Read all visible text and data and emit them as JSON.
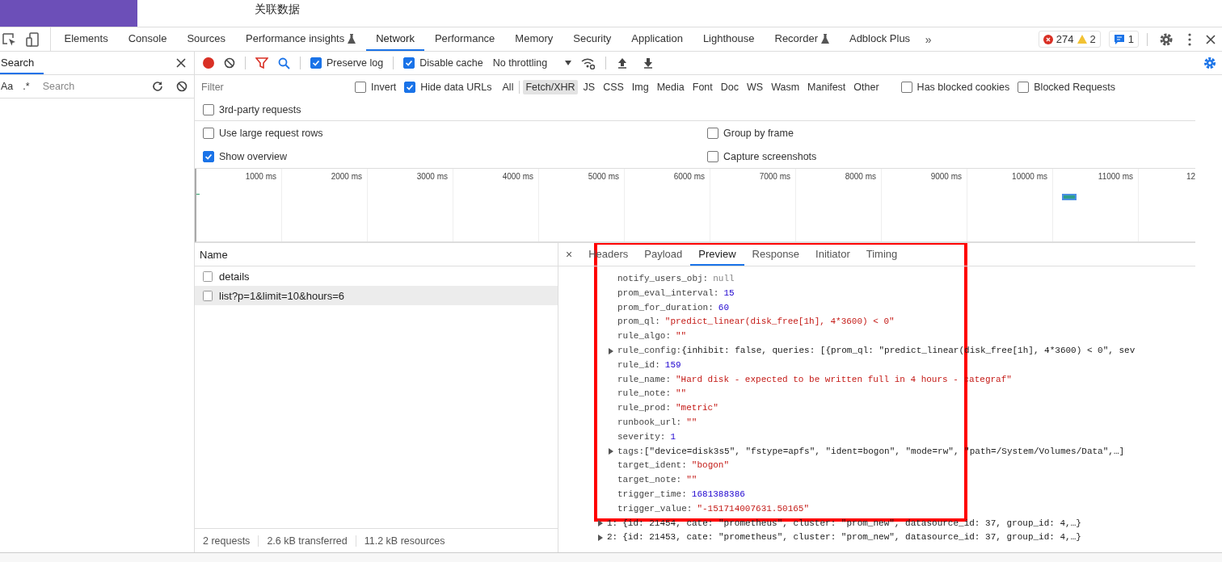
{
  "page_strip": {
    "tab_label": "关联数据"
  },
  "devtools": {
    "tabs": [
      {
        "label": "Elements",
        "selected": false,
        "experimental": false
      },
      {
        "label": "Console",
        "selected": false,
        "experimental": false
      },
      {
        "label": "Sources",
        "selected": false,
        "experimental": false
      },
      {
        "label": "Performance insights",
        "selected": false,
        "experimental": true
      },
      {
        "label": "Network",
        "selected": true,
        "experimental": false
      },
      {
        "label": "Performance",
        "selected": false,
        "experimental": false
      },
      {
        "label": "Memory",
        "selected": false,
        "experimental": false
      },
      {
        "label": "Security",
        "selected": false,
        "experimental": false
      },
      {
        "label": "Application",
        "selected": false,
        "experimental": false
      },
      {
        "label": "Lighthouse",
        "selected": false,
        "experimental": false
      },
      {
        "label": "Recorder",
        "selected": false,
        "experimental": true
      },
      {
        "label": "Adblock Plus",
        "selected": false,
        "experimental": false
      }
    ],
    "more_tabs": "»",
    "errors": "274",
    "warnings": "2",
    "messages": "1"
  },
  "search_panel": {
    "title": "Search",
    "match_case": "Aa",
    "regex": ".*",
    "placeholder": "Search"
  },
  "toolbar": {
    "recording": true,
    "preserve_log": {
      "label": "Preserve log",
      "checked": true
    },
    "disable_cache": {
      "label": "Disable cache",
      "checked": true
    },
    "throttling": "No throttling"
  },
  "filter": {
    "placeholder": "Filter",
    "invert": {
      "label": "Invert",
      "checked": false
    },
    "hide_data_urls": {
      "label": "Hide data URLs",
      "checked": true
    },
    "types": [
      {
        "label": "All",
        "selected": false
      },
      {
        "label": "Fetch/XHR",
        "selected": true
      },
      {
        "label": "JS",
        "selected": false
      },
      {
        "label": "CSS",
        "selected": false
      },
      {
        "label": "Img",
        "selected": false
      },
      {
        "label": "Media",
        "selected": false
      },
      {
        "label": "Font",
        "selected": false
      },
      {
        "label": "Doc",
        "selected": false
      },
      {
        "label": "WS",
        "selected": false
      },
      {
        "label": "Wasm",
        "selected": false
      },
      {
        "label": "Manifest",
        "selected": false
      },
      {
        "label": "Other",
        "selected": false
      }
    ],
    "has_blocked_cookies": {
      "label": "Has blocked cookies",
      "checked": false
    },
    "blocked_requests": {
      "label": "Blocked Requests",
      "checked": false
    },
    "third_party": {
      "label": "3rd-party requests",
      "checked": false
    }
  },
  "settings": [
    {
      "label": "Use large request rows",
      "checked": false
    },
    {
      "label": "Group by frame",
      "checked": false
    },
    {
      "label": "Show overview",
      "checked": true
    },
    {
      "label": "Capture screenshots",
      "checked": false
    }
  ],
  "overview": {
    "ticks": [
      "1000 ms",
      "2000 ms",
      "3000 ms",
      "4000 ms",
      "5000 ms",
      "6000 ms",
      "7000 ms",
      "8000 ms",
      "9000 ms",
      "10000 ms",
      "11000 ms",
      "12"
    ]
  },
  "requests": {
    "column": "Name",
    "rows": [
      {
        "name": "details",
        "selected": false
      },
      {
        "name": "list?p=1&limit=10&hours=6",
        "selected": true
      }
    ],
    "summary": [
      "2 requests",
      "2.6 kB transferred",
      "11.2 kB resources"
    ]
  },
  "details": {
    "close": "×",
    "tabs": [
      {
        "label": "Headers",
        "selected": false
      },
      {
        "label": "Payload",
        "selected": false
      },
      {
        "label": "Preview",
        "selected": true
      },
      {
        "label": "Response",
        "selected": false
      },
      {
        "label": "Initiator",
        "selected": false
      },
      {
        "label": "Timing",
        "selected": false
      }
    ],
    "lines": [
      {
        "key": "notify_users_obj:",
        "value": "null",
        "kind": "null",
        "expandable": false
      },
      {
        "key": "prom_eval_interval:",
        "value": "15",
        "kind": "number",
        "expandable": false
      },
      {
        "key": "prom_for_duration:",
        "value": "60",
        "kind": "number",
        "expandable": false
      },
      {
        "key": "prom_ql:",
        "value": "\"predict_linear(disk_free[1h], 4*3600) < 0\"",
        "kind": "string",
        "expandable": false
      },
      {
        "key": "rule_algo:",
        "value": "\"\"",
        "kind": "string",
        "expandable": false
      },
      {
        "key": "rule_config:",
        "value": "{inhibit: false, queries: [{prom_ql: \"predict_linear(disk_free[1h], 4*3600) < 0\", sev",
        "kind": "object",
        "expandable": true
      },
      {
        "key": "rule_id:",
        "value": "159",
        "kind": "number",
        "expandable": false
      },
      {
        "key": "rule_name:",
        "value": "\"Hard disk - expected to be written full in 4 hours - categraf\"",
        "kind": "string",
        "expandable": false
      },
      {
        "key": "rule_note:",
        "value": "\"\"",
        "kind": "string",
        "expandable": false
      },
      {
        "key": "rule_prod:",
        "value": "\"metric\"",
        "kind": "string",
        "expandable": false
      },
      {
        "key": "runbook_url:",
        "value": "\"\"",
        "kind": "string",
        "expandable": false
      },
      {
        "key": "severity:",
        "value": "1",
        "kind": "number",
        "expandable": false
      },
      {
        "key": "tags:",
        "value": "[\"device=disk3s5\", \"fstype=apfs\", \"ident=bogon\", \"mode=rw\", \"path=/System/Volumes/Data\",…]",
        "kind": "object",
        "expandable": true
      },
      {
        "key": "target_ident:",
        "value": "\"bogon\"",
        "kind": "string",
        "expandable": false
      },
      {
        "key": "target_note:",
        "value": "\"\"",
        "kind": "string",
        "expandable": false
      },
      {
        "key": "trigger_time:",
        "value": "1681388386",
        "kind": "number",
        "expandable": false
      },
      {
        "key": "trigger_value:",
        "value": "\"-151714007631.50165\"",
        "kind": "string",
        "expandable": false
      }
    ],
    "items": [
      {
        "index": "1:",
        "summary": "{id: 21454, cate: \"prometheus\", cluster: \"prom_new\", datasource_id: 37, group_id: 4,…}"
      },
      {
        "index": "2:",
        "summary": "{id: 21453, cate: \"prometheus\", cluster: \"prom_new\", datasource_id: 37, group_id: 4,…}"
      }
    ]
  }
}
